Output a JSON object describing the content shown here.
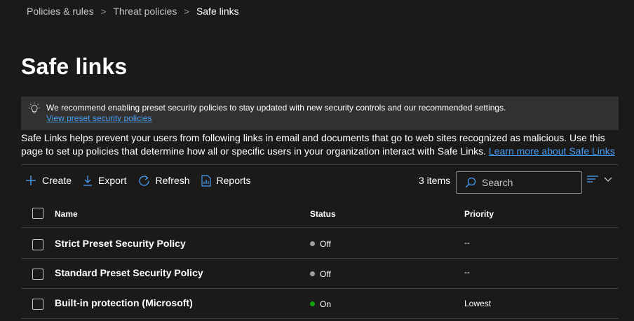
{
  "breadcrumb": {
    "item1": "Policies & rules",
    "item2": "Threat policies",
    "item3": "Safe links",
    "separator": ">"
  },
  "page": {
    "title": "Safe links"
  },
  "banner": {
    "icon": "lightbulb-icon",
    "message": "We recommend enabling preset security policies to stay updated with new security controls and our recommended settings.",
    "link": "View preset security policies"
  },
  "description": {
    "text": "Safe Links helps prevent your users from following links in email and documents that go to web sites recognized as malicious. Use this page to set up policies that determine how all or specific users in your organization interact with Safe Links.",
    "link": "Learn more about Safe Links"
  },
  "toolbar": {
    "create": "Create",
    "export": "Export",
    "refresh": "Refresh",
    "reports": "Reports",
    "count": "3 items",
    "search_placeholder": "Search"
  },
  "table": {
    "columns": {
      "name": "Name",
      "status": "Status",
      "priority": "Priority"
    },
    "rows": [
      {
        "name": "Strict Preset Security Policy",
        "status": "Off",
        "status_color": "#a19f9d",
        "priority": "--"
      },
      {
        "name": "Standard Preset Security Policy",
        "status": "Off",
        "status_color": "#a19f9d",
        "priority": "--"
      },
      {
        "name": "Built-in protection (Microsoft)",
        "status": "On",
        "status_color": "#13a10e",
        "priority": "Lowest"
      }
    ]
  },
  "colors": {
    "background": "#1b1a19",
    "accent": "#479ef5",
    "banner": "#323130"
  }
}
